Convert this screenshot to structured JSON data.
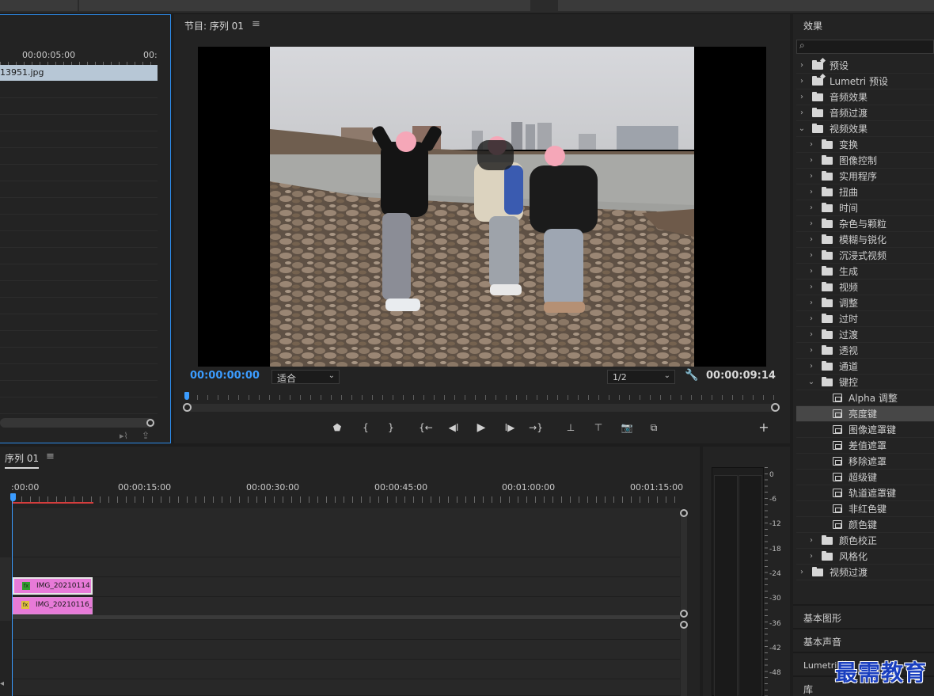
{
  "source_panel": {
    "ruler_labels": [
      "00:00:05:00",
      "00:"
    ],
    "clip_name": "13951.jpg"
  },
  "program_monitor": {
    "title": "节目: 序列 01",
    "menu_icon": "hamburger-icon",
    "current_timecode": "00:00:00:00",
    "zoom_select": "适合",
    "resolution_select": "1/2",
    "duration_timecode": "00:00:09:14",
    "playhead_position_fraction": 0.0,
    "transport": {
      "add_marker": "⬟",
      "mark_in": "{",
      "mark_out": "}",
      "go_to_in": "{←",
      "step_back": "◀I",
      "play": "▶",
      "step_forward": "I▶",
      "go_to_out": "→}",
      "lift": "⊥",
      "extract": "⊤",
      "export_frame": "📷",
      "compare": "⧉",
      "add": "+"
    }
  },
  "effects_panel": {
    "title": "效果",
    "search_placeholder": "",
    "items": [
      {
        "label": "预设",
        "level": 0,
        "type": "preset-folder",
        "expanded": false
      },
      {
        "label": "Lumetri 预设",
        "level": 0,
        "type": "preset-folder",
        "expanded": false
      },
      {
        "label": "音频效果",
        "level": 0,
        "type": "folder",
        "expanded": false
      },
      {
        "label": "音频过渡",
        "level": 0,
        "type": "folder",
        "expanded": false
      },
      {
        "label": "视频效果",
        "level": 0,
        "type": "folder",
        "expanded": true
      },
      {
        "label": "变换",
        "level": 1,
        "type": "folder",
        "expanded": false
      },
      {
        "label": "图像控制",
        "level": 1,
        "type": "folder",
        "expanded": false
      },
      {
        "label": "实用程序",
        "level": 1,
        "type": "folder",
        "expanded": false
      },
      {
        "label": "扭曲",
        "level": 1,
        "type": "folder",
        "expanded": false
      },
      {
        "label": "时间",
        "level": 1,
        "type": "folder",
        "expanded": false
      },
      {
        "label": "杂色与颗粒",
        "level": 1,
        "type": "folder",
        "expanded": false
      },
      {
        "label": "模糊与锐化",
        "level": 1,
        "type": "folder",
        "expanded": false
      },
      {
        "label": "沉浸式视频",
        "level": 1,
        "type": "folder",
        "expanded": false
      },
      {
        "label": "生成",
        "level": 1,
        "type": "folder",
        "expanded": false
      },
      {
        "label": "视频",
        "level": 1,
        "type": "folder",
        "expanded": false
      },
      {
        "label": "调整",
        "level": 1,
        "type": "folder",
        "expanded": false
      },
      {
        "label": "过时",
        "level": 1,
        "type": "folder",
        "expanded": false
      },
      {
        "label": "过渡",
        "level": 1,
        "type": "folder",
        "expanded": false
      },
      {
        "label": "透视",
        "level": 1,
        "type": "folder",
        "expanded": false
      },
      {
        "label": "通道",
        "level": 1,
        "type": "folder",
        "expanded": false
      },
      {
        "label": "键控",
        "level": 1,
        "type": "folder",
        "expanded": true
      },
      {
        "label": "Alpha 调整",
        "level": 2,
        "type": "effect"
      },
      {
        "label": "亮度键",
        "level": 2,
        "type": "effect",
        "selected": true
      },
      {
        "label": "图像遮罩键",
        "level": 2,
        "type": "effect"
      },
      {
        "label": "差值遮罩",
        "level": 2,
        "type": "effect"
      },
      {
        "label": "移除遮罩",
        "level": 2,
        "type": "effect"
      },
      {
        "label": "超级键",
        "level": 2,
        "type": "effect"
      },
      {
        "label": "轨道遮罩键",
        "level": 2,
        "type": "effect"
      },
      {
        "label": "非红色键",
        "level": 2,
        "type": "effect"
      },
      {
        "label": "颜色键",
        "level": 2,
        "type": "effect"
      },
      {
        "label": "颜色校正",
        "level": 1,
        "type": "folder",
        "expanded": false
      },
      {
        "label": "风格化",
        "level": 1,
        "type": "folder",
        "expanded": false
      },
      {
        "label": "视频过渡",
        "level": 0,
        "type": "folder",
        "expanded": false
      }
    ],
    "sub_panels": [
      "基本图形",
      "基本声音",
      "Lumetri 范",
      "库"
    ]
  },
  "timeline": {
    "tab_label": "序列 01",
    "menu_icon": "hamburger-icon",
    "timecodes": [
      ":00:00",
      "00:00:15:00",
      "00:00:30:00",
      "00:00:45:00",
      "00:01:00:00",
      "00:01:15:00"
    ],
    "clips": [
      {
        "name": "IMG_20210114",
        "fx": "fx",
        "fx_color": "#2f9e2f",
        "selected": true
      },
      {
        "name": "IMG_20210116_",
        "fx": "fx",
        "fx_color": "#e0c040",
        "selected": false
      }
    ]
  },
  "audio_meter": {
    "labels": [
      "0",
      "-6",
      "-12",
      "-18",
      "-24",
      "-30",
      "-36",
      "-42",
      "-48"
    ]
  },
  "watermark": "最需教育",
  "colors": {
    "accent_blue": "#3b9cff",
    "clip_pink": "#e77ad8",
    "in_out_red": "#d43d3d"
  }
}
